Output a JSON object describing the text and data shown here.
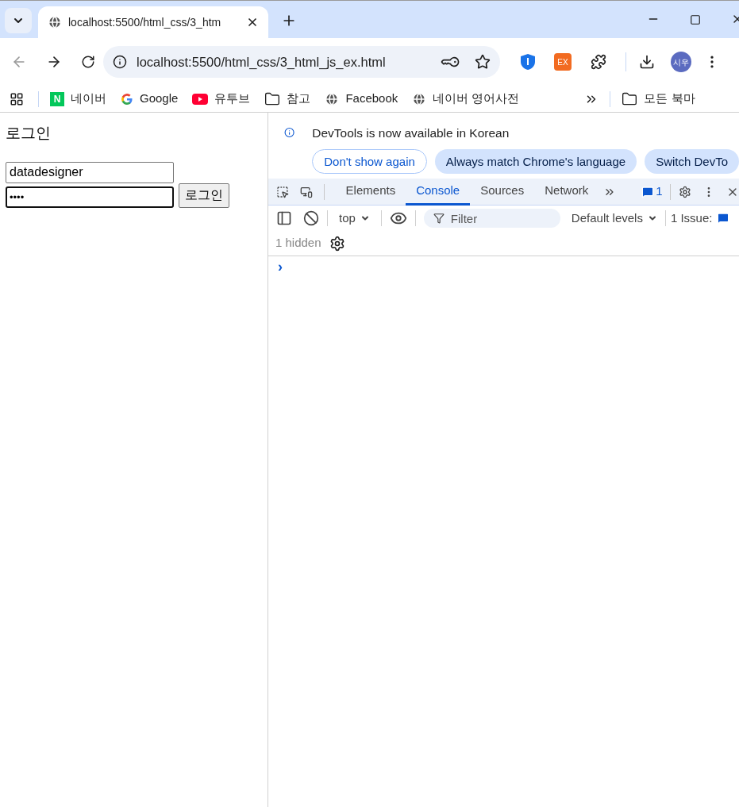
{
  "browser": {
    "tabs": [
      {
        "title": "localhost:5500/html_css/3_htm",
        "selected": true
      }
    ],
    "address": "localhost:5500/html_css/3_html_js_ex.html",
    "extension_badge": "EX",
    "profile": "시우",
    "bookmarks": [
      {
        "label": "네이버",
        "kind": "naver",
        "icon_text": "N"
      },
      {
        "label": "Google",
        "kind": "google"
      },
      {
        "label": "유투브",
        "kind": "youtube"
      },
      {
        "label": "참고",
        "kind": "folder"
      },
      {
        "label": "Facebook",
        "kind": "globe"
      },
      {
        "label": "네이버 영어사전",
        "kind": "globe"
      }
    ],
    "all_bookmarks": "모든 북마"
  },
  "page": {
    "heading": "로그인",
    "username": "datadesigner",
    "password": "••••",
    "button": "로그인"
  },
  "devtools": {
    "infobar": {
      "message": "DevTools is now available in Korean",
      "buttons": [
        {
          "label": "Don't show again",
          "kind": "outline"
        },
        {
          "label": "Always match Chrome's language",
          "kind": "filled"
        },
        {
          "label": "Switch DevTo",
          "kind": "filled"
        }
      ]
    },
    "tabs": [
      {
        "label": "Elements",
        "selected": false
      },
      {
        "label": "Console",
        "selected": true
      },
      {
        "label": "Sources",
        "selected": false
      },
      {
        "label": "Network",
        "selected": false
      }
    ],
    "issues_count": "1",
    "console": {
      "context": "top",
      "filter_placeholder": "Filter",
      "levels": "Default levels",
      "issues": "1 Issue:",
      "hidden": "1 hidden",
      "prompt": "›"
    }
  }
}
